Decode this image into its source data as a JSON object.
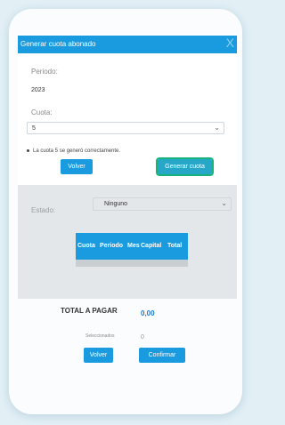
{
  "modal": {
    "title": "Generar cuota abonado",
    "close_label": "X"
  },
  "periodo": {
    "label": "Periodo:",
    "value": "2023"
  },
  "cuota": {
    "label": "Cuota:",
    "selected": "5"
  },
  "message": "La cuota 5 se generó correctamente.",
  "buttons": {
    "volver": "Volver",
    "generar": "Generar cuota",
    "volver2": "Volver",
    "confirmar": "Confirmar"
  },
  "estado": {
    "label": "Estado:",
    "selected": "Ninguno"
  },
  "table": {
    "columns": [
      "Cuota",
      "Periodo",
      "Mes",
      "Capital",
      "Total"
    ]
  },
  "total": {
    "label": "TOTAL A PAGAR",
    "value": "0,00"
  },
  "seleccionados": {
    "label": "Seleccionados",
    "value": "0"
  },
  "colors": {
    "primary": "#1a9be0",
    "background": "#e2f0f6",
    "panel": "#e4e7ea"
  }
}
